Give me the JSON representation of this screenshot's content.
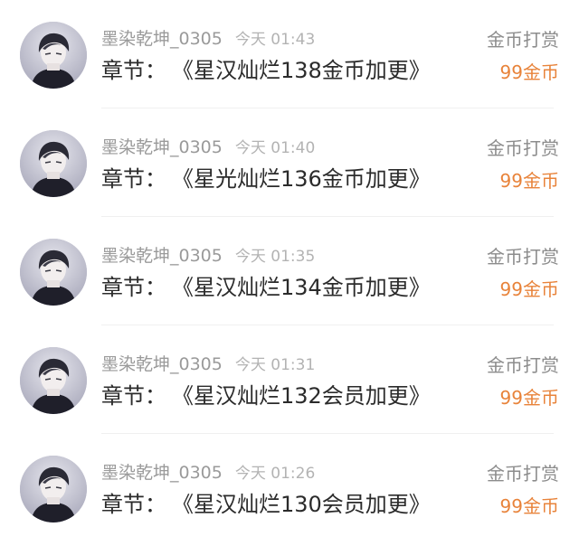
{
  "records": [
    {
      "username": "墨染乾坤_0305",
      "time": "今天 01:43",
      "chapter_label": "章节：",
      "chapter_title": "《星汉灿烂138金币加更》",
      "type": "金币打赏",
      "amount": "99金币"
    },
    {
      "username": "墨染乾坤_0305",
      "time": "今天 01:40",
      "chapter_label": "章节：",
      "chapter_title": "《星光灿烂136金币加更》",
      "type": "金币打赏",
      "amount": "99金币"
    },
    {
      "username": "墨染乾坤_0305",
      "time": "今天 01:35",
      "chapter_label": "章节：",
      "chapter_title": "《星汉灿烂134金币加更》",
      "type": "金币打赏",
      "amount": "99金币"
    },
    {
      "username": "墨染乾坤_0305",
      "time": "今天 01:31",
      "chapter_label": "章节：",
      "chapter_title": "《星汉灿烂132会员加更》",
      "type": "金币打赏",
      "amount": "99金币"
    },
    {
      "username": "墨染乾坤_0305",
      "time": "今天 01:26",
      "chapter_label": "章节：",
      "chapter_title": "《星汉灿烂130会员加更》",
      "type": "金币打赏",
      "amount": "99金币"
    }
  ],
  "colors": {
    "username": "#9a9a9a",
    "time": "#b3b3b3",
    "chapter": "#2b2b2b",
    "type": "#8c8c8c",
    "amount": "#e8833a"
  },
  "icons": {
    "avatar": "user-portrait-avatar"
  }
}
